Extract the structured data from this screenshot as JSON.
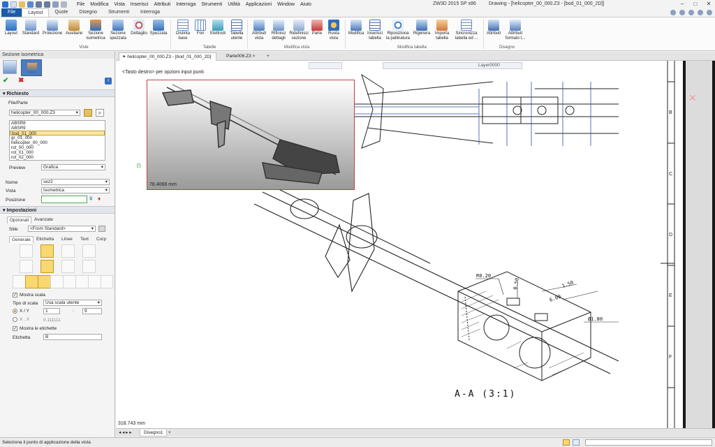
{
  "window": {
    "app_title": "ZW3D 2015 SP x86",
    "doc_title": "Drawing - [helicopter_00_000.Z3 - [bod_01_000_2D]]"
  },
  "menu": [
    "File",
    "Modifica",
    "Vista",
    "Inserisci",
    "Attributi",
    "Interroga",
    "Strumenti",
    "Utilità",
    "Applicazioni",
    "Window",
    "Aiuto"
  ],
  "ribbon_tabs": [
    "File",
    "Layout",
    "Quote",
    "Disegno",
    "Strumenti",
    "Interroga"
  ],
  "ribbon": {
    "viste": {
      "label": "Viste",
      "buttons": [
        "Layout",
        "Standard",
        "Proiezione",
        "Ausiliarie",
        "Sezione isometrica",
        "Sezione spezzata",
        "Dettaglio",
        "Spezzata"
      ]
    },
    "tabelle": {
      "label": "Tabelle",
      "buttons": [
        "Distinta base",
        "Fori",
        "Elettrodi",
        "Tabella utente"
      ]
    },
    "modifica_vista": {
      "label": "Modifica vista",
      "buttons": [
        "Attributi vista",
        "Rifinisci dettagli",
        "Ridefinisci sezione",
        "Parte",
        "Ruota vista"
      ]
    },
    "modifica_tabella": {
      "label": "Modifica tabella",
      "buttons": [
        "Modifica",
        "Inserisci tabella",
        "Riposiziona la pallinatura",
        "Rigenera",
        "Importa tabella",
        "Sincronizza tabella ed ..."
      ]
    },
    "disegno": {
      "label": "Disegno",
      "buttons": [
        "Attributi",
        "Attributi formato t..."
      ]
    }
  },
  "left_panel": {
    "title": "Sezione isometrica",
    "richiesto": "Richiesto",
    "file_parte": "File/Parte",
    "file_value": "helicopter_00_000.Z3",
    "files": [
      "ABSR8",
      "ABSR9",
      "bod_01_000",
      "gr_01_000",
      "helicopter_00_000",
      "rot_00_000",
      "rot_01_000",
      "rot_02_000"
    ],
    "selected_file_index": 2,
    "preview_label": "Preview",
    "preview_value": "Grafica",
    "nome_label": "Nome",
    "nome_value": "sez2",
    "vista_label": "Vista",
    "vista_value": "Isometrica",
    "posizione_label": "Posizione",
    "impostazioni": "Impostazioni",
    "tabs": [
      "Opzionali",
      "Avanzate"
    ],
    "stile_label": "Stile",
    "stile_value": "<From Standard>",
    "subtabs": [
      "Generale",
      "Etichetta",
      "Linee",
      "Text",
      "Corp"
    ],
    "mostra_scala": "Mostra scala",
    "tipo_scala_label": "Tipo di scala",
    "tipo_scala_value": "Usa scala utente",
    "xy_label": "X / Y",
    "xy_num": "1",
    "xy_sep": ":",
    "xy_den": "9",
    "xx_label": "X . X",
    "xx_value": "0.111111",
    "mostra_etichette": "Mostra le etichette",
    "etichetta_label": "Etichetta",
    "etichetta_value": "B"
  },
  "doc_tabs": [
    "helicopter_00_000.Z3 - [bod_01_000_2D]",
    "Parte006.Z3"
  ],
  "canvas": {
    "hint": "<Tasto destro> per opzioni input punti",
    "preview_dim": "78.4066 mm",
    "canvas_dim": "318.743 mm",
    "section_label": "A-A  (3:1)",
    "layer": "Layer0000",
    "dims": [
      "R0.20",
      "0.50",
      "1.50",
      "6.00",
      "Ø1.80"
    ],
    "border_letters": [
      "B",
      "C",
      "D",
      "E",
      "F"
    ]
  },
  "sheet_tabs": [
    "Disegno1"
  ],
  "status": "Seleziona il punto di applicazione della vista",
  "colors": {
    "file_tab": "#1e5aa8",
    "selection": "#fbe7a0",
    "preview_border": "#c04040",
    "accent_blue": "#2a4fa8"
  }
}
